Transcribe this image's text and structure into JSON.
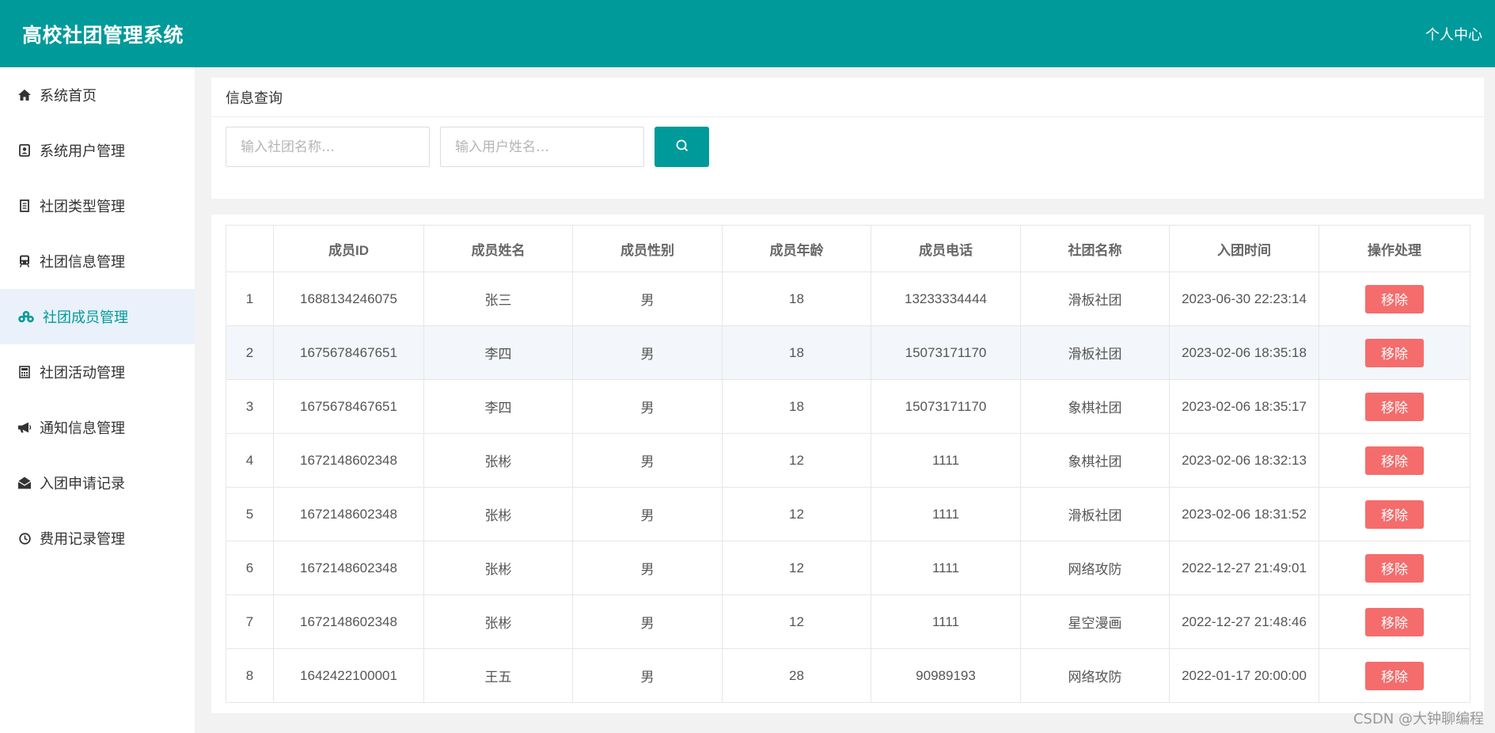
{
  "header": {
    "title": "高校社团管理系统",
    "user_center": "个人中心"
  },
  "sidebar": {
    "items": [
      {
        "label": "系统首页",
        "icon": "home-icon"
      },
      {
        "label": "系统用户管理",
        "icon": "user-card-icon"
      },
      {
        "label": "社团类型管理",
        "icon": "document-icon"
      },
      {
        "label": "社团信息管理",
        "icon": "train-icon"
      },
      {
        "label": "社团成员管理",
        "icon": "cubes-icon",
        "active": true
      },
      {
        "label": "社团活动管理",
        "icon": "calculator-icon"
      },
      {
        "label": "通知信息管理",
        "icon": "megaphone-icon"
      },
      {
        "label": "入团申请记录",
        "icon": "envelope-open-icon"
      },
      {
        "label": "费用记录管理",
        "icon": "clock-icon"
      }
    ]
  },
  "search": {
    "title": "信息查询",
    "club_placeholder": "输入社团名称…",
    "user_placeholder": "输入用户姓名…"
  },
  "table": {
    "headers": [
      "",
      "成员ID",
      "成员姓名",
      "成员性别",
      "成员年龄",
      "成员电话",
      "社团名称",
      "入团时间",
      "操作处理"
    ],
    "action_label": "移除",
    "rows": [
      [
        "1",
        "1688134246075",
        "张三",
        "男",
        "18",
        "13233334444",
        "滑板社团",
        "2023-06-30 22:23:14"
      ],
      [
        "2",
        "1675678467651",
        "李四",
        "男",
        "18",
        "15073171170",
        "滑板社团",
        "2023-02-06 18:35:18"
      ],
      [
        "3",
        "1675678467651",
        "李四",
        "男",
        "18",
        "15073171170",
        "象棋社团",
        "2023-02-06 18:35:17"
      ],
      [
        "4",
        "1672148602348",
        "张彬",
        "男",
        "12",
        "1111",
        "象棋社团",
        "2023-02-06 18:32:13"
      ],
      [
        "5",
        "1672148602348",
        "张彬",
        "男",
        "12",
        "1111",
        "滑板社团",
        "2023-02-06 18:31:52"
      ],
      [
        "6",
        "1672148602348",
        "张彬",
        "男",
        "12",
        "1111",
        "网络攻防",
        "2022-12-27 21:49:01"
      ],
      [
        "7",
        "1672148602348",
        "张彬",
        "男",
        "12",
        "1111",
        "星空漫画",
        "2022-12-27 21:48:46"
      ],
      [
        "8",
        "1642422100001",
        "王五",
        "男",
        "28",
        "90989193",
        "网络攻防",
        "2022-01-17 20:00:00"
      ]
    ]
  },
  "watermark": "CSDN @大钟聊编程",
  "colors": {
    "primary": "#009a9a",
    "danger": "#f56c6c",
    "active_bg": "#eaf1fb"
  }
}
